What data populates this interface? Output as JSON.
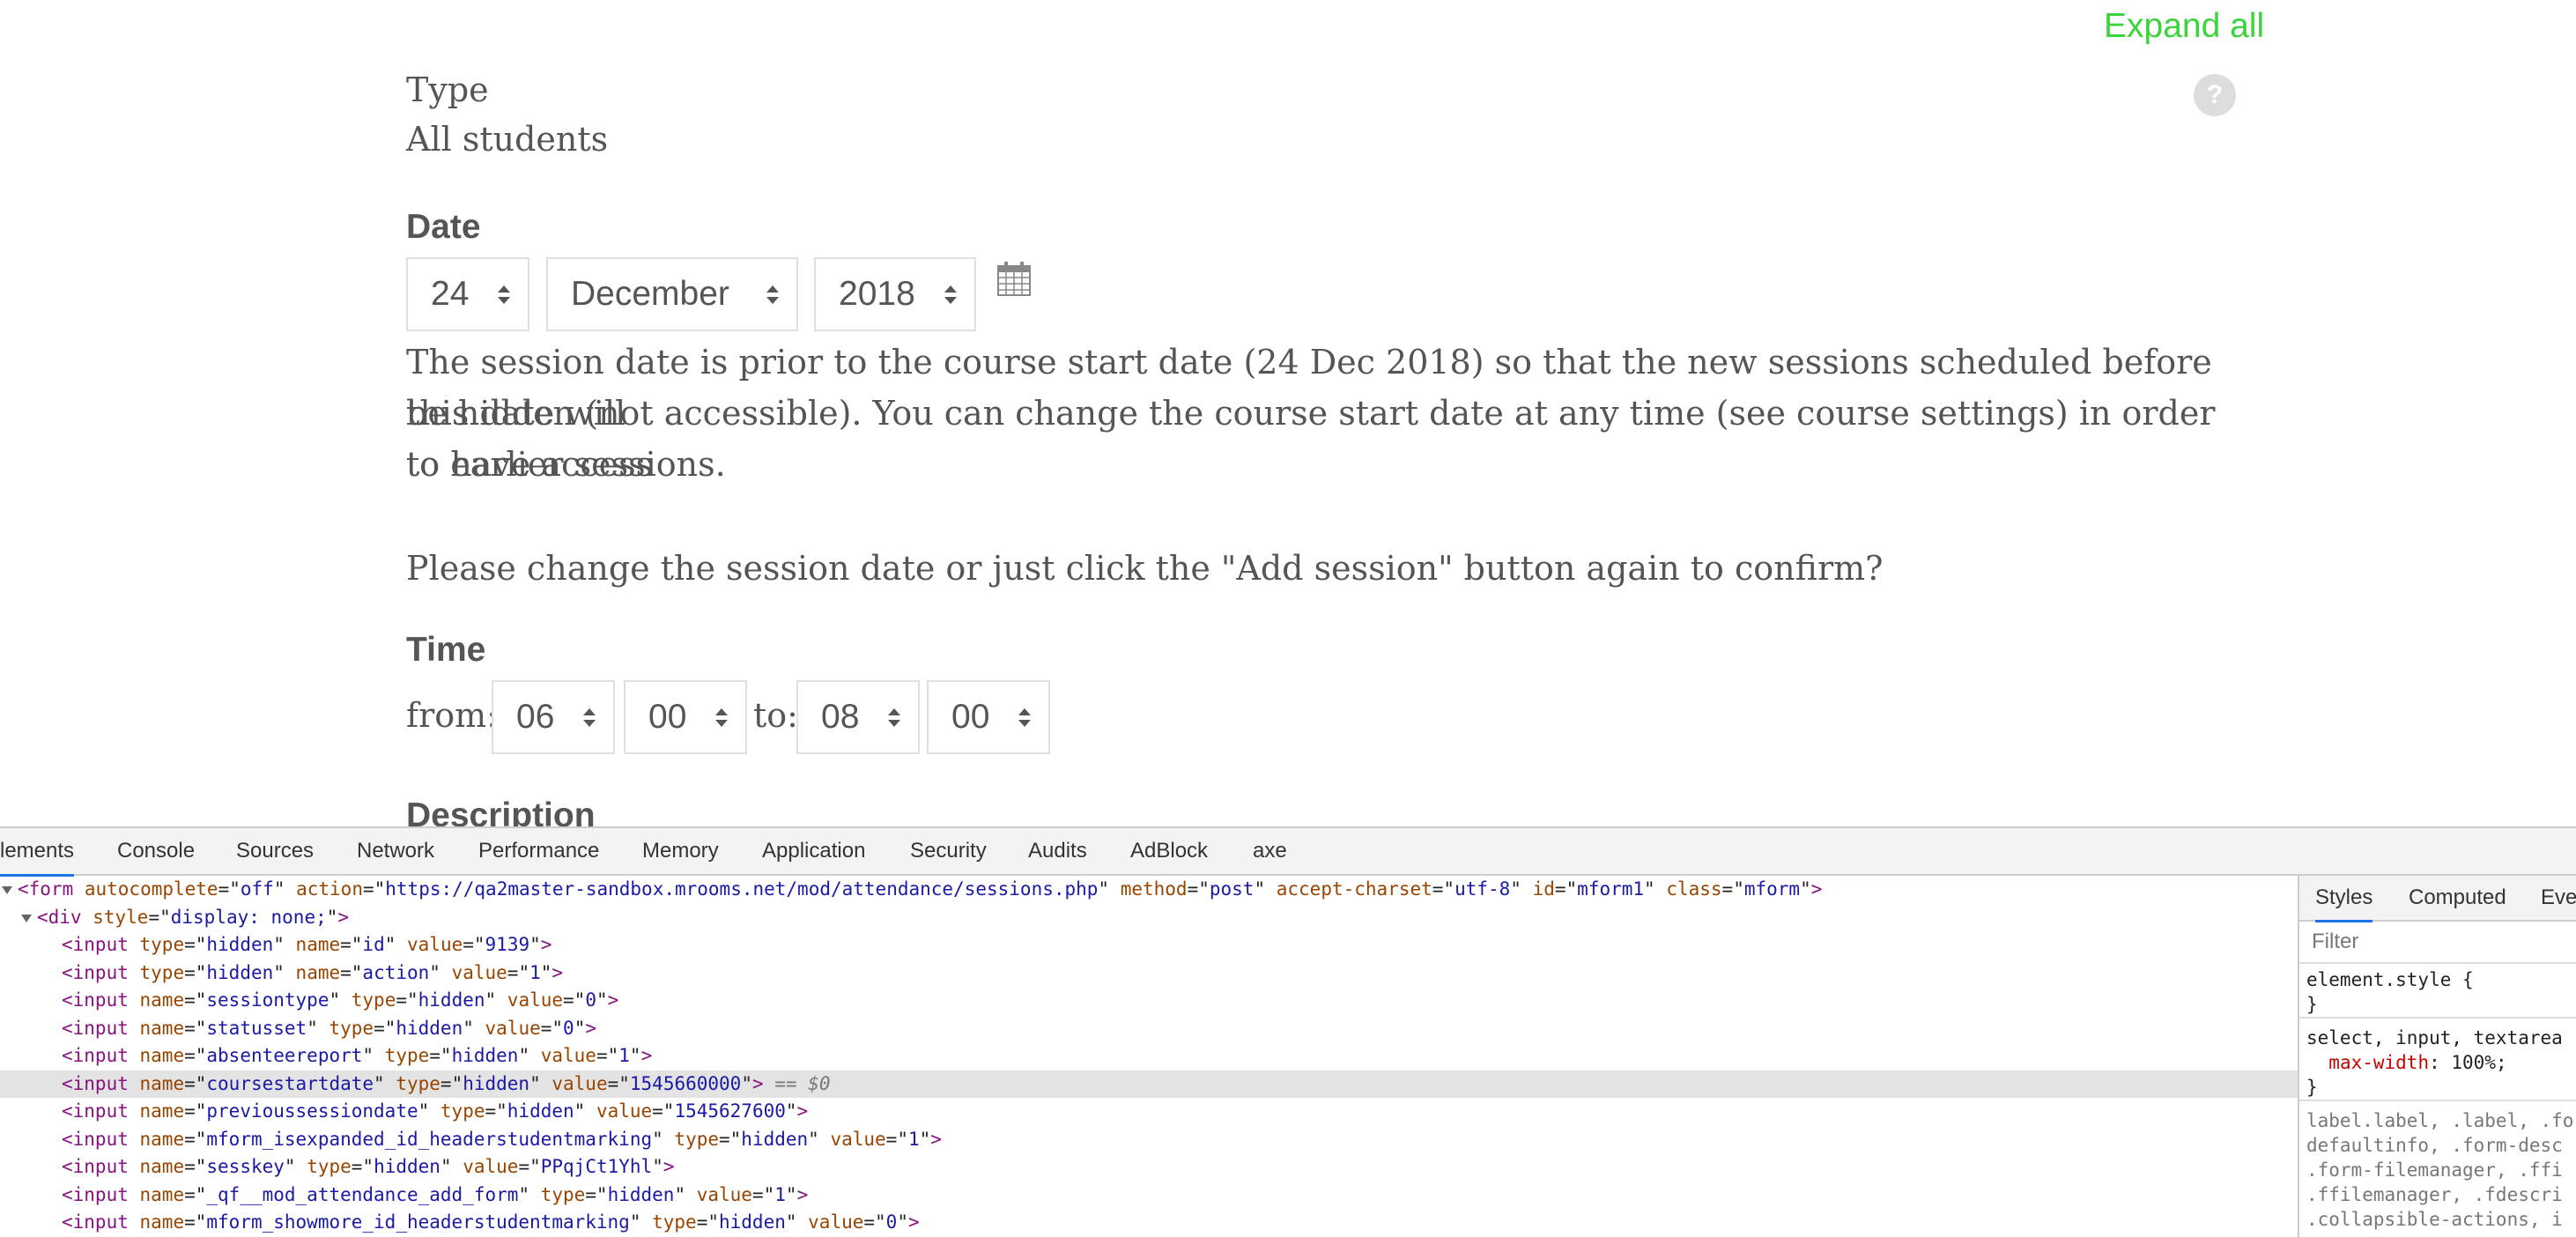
{
  "header": {
    "expand_all": "Expand all",
    "help_icon": "?"
  },
  "type_field": {
    "label": "Type",
    "value": "All students"
  },
  "date_field": {
    "label": "Date",
    "day": "24",
    "month": "December",
    "year": "2018",
    "calendar_icon": "calendar-icon"
  },
  "warning": {
    "line1": "The session date is prior to the course start date (24 Dec 2018) so that the new sessions scheduled before this date will",
    "line2": "be hidden (not accessible). You can change the course start date at any time (see course settings) in order to have access",
    "line3": "to earlier sessions.",
    "confirm": "Please change the session date or just click the \"Add session\" button again to confirm?"
  },
  "time_field": {
    "label": "Time",
    "from_label": "from:",
    "from_hour": "06",
    "from_minute": "00",
    "to_label": "to:",
    "to_hour": "08",
    "to_minute": "00"
  },
  "description_label": "Description",
  "devtools": {
    "tabs": [
      "lements",
      "Console",
      "Sources",
      "Network",
      "Performance",
      "Memory",
      "Application",
      "Security",
      "Audits",
      "AdBlock",
      "axe"
    ],
    "active_tab": "lements",
    "code_lines": [
      {
        "indent": 0,
        "tri": true,
        "parts": [
          [
            "tg",
            "<form "
          ],
          [
            "an",
            "autocomplete"
          ],
          [
            "pl",
            "=\""
          ],
          [
            "av",
            "off"
          ],
          [
            "pl",
            "\" "
          ],
          [
            "an",
            "action"
          ],
          [
            "pl",
            "=\""
          ],
          [
            "av",
            "https://qa2master-sandbox.mrooms.net/mod/attendance/sessions.php"
          ],
          [
            "pl",
            "\" "
          ],
          [
            "an",
            "method"
          ],
          [
            "pl",
            "=\""
          ],
          [
            "av",
            "post"
          ],
          [
            "pl",
            "\" "
          ],
          [
            "an",
            "accept-charset"
          ],
          [
            "pl",
            "=\""
          ],
          [
            "av",
            "utf-8"
          ],
          [
            "pl",
            "\" "
          ],
          [
            "an",
            "id"
          ],
          [
            "pl",
            "=\""
          ],
          [
            "av",
            "mform1"
          ],
          [
            "pl",
            "\" "
          ],
          [
            "an",
            "class"
          ],
          [
            "pl",
            "=\""
          ],
          [
            "av",
            "mform"
          ],
          [
            "pl",
            "\""
          ],
          [
            "tg",
            ">"
          ]
        ]
      },
      {
        "indent": 1,
        "tri": true,
        "parts": [
          [
            "tg",
            "<div "
          ],
          [
            "an",
            "style"
          ],
          [
            "pl",
            "=\""
          ],
          [
            "av",
            "display: none;"
          ],
          [
            "pl",
            "\""
          ],
          [
            "tg",
            ">"
          ]
        ]
      },
      {
        "indent": 2,
        "tri": false,
        "parts": [
          [
            "tg",
            "<input "
          ],
          [
            "an",
            "type"
          ],
          [
            "pl",
            "=\""
          ],
          [
            "av",
            "hidden"
          ],
          [
            "pl",
            "\" "
          ],
          [
            "an",
            "name"
          ],
          [
            "pl",
            "=\""
          ],
          [
            "av",
            "id"
          ],
          [
            "pl",
            "\" "
          ],
          [
            "an",
            "value"
          ],
          [
            "pl",
            "=\""
          ],
          [
            "av",
            "9139"
          ],
          [
            "pl",
            "\""
          ],
          [
            "tg",
            ">"
          ]
        ]
      },
      {
        "indent": 2,
        "tri": false,
        "parts": [
          [
            "tg",
            "<input "
          ],
          [
            "an",
            "type"
          ],
          [
            "pl",
            "=\""
          ],
          [
            "av",
            "hidden"
          ],
          [
            "pl",
            "\" "
          ],
          [
            "an",
            "name"
          ],
          [
            "pl",
            "=\""
          ],
          [
            "av",
            "action"
          ],
          [
            "pl",
            "\" "
          ],
          [
            "an",
            "value"
          ],
          [
            "pl",
            "=\""
          ],
          [
            "av",
            "1"
          ],
          [
            "pl",
            "\""
          ],
          [
            "tg",
            ">"
          ]
        ]
      },
      {
        "indent": 2,
        "tri": false,
        "parts": [
          [
            "tg",
            "<input "
          ],
          [
            "an",
            "name"
          ],
          [
            "pl",
            "=\""
          ],
          [
            "av",
            "sessiontype"
          ],
          [
            "pl",
            "\" "
          ],
          [
            "an",
            "type"
          ],
          [
            "pl",
            "=\""
          ],
          [
            "av",
            "hidden"
          ],
          [
            "pl",
            "\" "
          ],
          [
            "an",
            "value"
          ],
          [
            "pl",
            "=\""
          ],
          [
            "av",
            "0"
          ],
          [
            "pl",
            "\""
          ],
          [
            "tg",
            ">"
          ]
        ]
      },
      {
        "indent": 2,
        "tri": false,
        "parts": [
          [
            "tg",
            "<input "
          ],
          [
            "an",
            "name"
          ],
          [
            "pl",
            "=\""
          ],
          [
            "av",
            "statusset"
          ],
          [
            "pl",
            "\" "
          ],
          [
            "an",
            "type"
          ],
          [
            "pl",
            "=\""
          ],
          [
            "av",
            "hidden"
          ],
          [
            "pl",
            "\" "
          ],
          [
            "an",
            "value"
          ],
          [
            "pl",
            "=\""
          ],
          [
            "av",
            "0"
          ],
          [
            "pl",
            "\""
          ],
          [
            "tg",
            ">"
          ]
        ]
      },
      {
        "indent": 2,
        "tri": false,
        "parts": [
          [
            "tg",
            "<input "
          ],
          [
            "an",
            "name"
          ],
          [
            "pl",
            "=\""
          ],
          [
            "av",
            "absenteereport"
          ],
          [
            "pl",
            "\" "
          ],
          [
            "an",
            "type"
          ],
          [
            "pl",
            "=\""
          ],
          [
            "av",
            "hidden"
          ],
          [
            "pl",
            "\" "
          ],
          [
            "an",
            "value"
          ],
          [
            "pl",
            "=\""
          ],
          [
            "av",
            "1"
          ],
          [
            "pl",
            "\""
          ],
          [
            "tg",
            ">"
          ]
        ]
      },
      {
        "indent": 2,
        "tri": false,
        "selected": true,
        "parts": [
          [
            "tg",
            "<input "
          ],
          [
            "an",
            "name"
          ],
          [
            "pl",
            "=\""
          ],
          [
            "av",
            "coursestartdate"
          ],
          [
            "pl",
            "\" "
          ],
          [
            "an",
            "type"
          ],
          [
            "pl",
            "=\""
          ],
          [
            "av",
            "hidden"
          ],
          [
            "pl",
            "\" "
          ],
          [
            "an",
            "value"
          ],
          [
            "pl",
            "=\""
          ],
          [
            "av",
            "1545660000"
          ],
          [
            "pl",
            "\""
          ],
          [
            "tg",
            ">"
          ],
          [
            "sel-note",
            " == $0"
          ]
        ]
      },
      {
        "indent": 2,
        "tri": false,
        "parts": [
          [
            "tg",
            "<input "
          ],
          [
            "an",
            "name"
          ],
          [
            "pl",
            "=\""
          ],
          [
            "av",
            "previoussessiondate"
          ],
          [
            "pl",
            "\" "
          ],
          [
            "an",
            "type"
          ],
          [
            "pl",
            "=\""
          ],
          [
            "av",
            "hidden"
          ],
          [
            "pl",
            "\" "
          ],
          [
            "an",
            "value"
          ],
          [
            "pl",
            "=\""
          ],
          [
            "av",
            "1545627600"
          ],
          [
            "pl",
            "\""
          ],
          [
            "tg",
            ">"
          ]
        ]
      },
      {
        "indent": 2,
        "tri": false,
        "parts": [
          [
            "tg",
            "<input "
          ],
          [
            "an",
            "name"
          ],
          [
            "pl",
            "=\""
          ],
          [
            "av",
            "mform_isexpanded_id_headerstudentmarking"
          ],
          [
            "pl",
            "\" "
          ],
          [
            "an",
            "type"
          ],
          [
            "pl",
            "=\""
          ],
          [
            "av",
            "hidden"
          ],
          [
            "pl",
            "\" "
          ],
          [
            "an",
            "value"
          ],
          [
            "pl",
            "=\""
          ],
          [
            "av",
            "1"
          ],
          [
            "pl",
            "\""
          ],
          [
            "tg",
            ">"
          ]
        ]
      },
      {
        "indent": 2,
        "tri": false,
        "parts": [
          [
            "tg",
            "<input "
          ],
          [
            "an",
            "name"
          ],
          [
            "pl",
            "=\""
          ],
          [
            "av",
            "sesskey"
          ],
          [
            "pl",
            "\" "
          ],
          [
            "an",
            "type"
          ],
          [
            "pl",
            "=\""
          ],
          [
            "av",
            "hidden"
          ],
          [
            "pl",
            "\" "
          ],
          [
            "an",
            "value"
          ],
          [
            "pl",
            "=\""
          ],
          [
            "av",
            "PPqjCt1Yhl"
          ],
          [
            "pl",
            "\""
          ],
          [
            "tg",
            ">"
          ]
        ]
      },
      {
        "indent": 2,
        "tri": false,
        "parts": [
          [
            "tg",
            "<input "
          ],
          [
            "an",
            "name"
          ],
          [
            "pl",
            "=\""
          ],
          [
            "av",
            "_qf__mod_attendance_add_form"
          ],
          [
            "pl",
            "\" "
          ],
          [
            "an",
            "type"
          ],
          [
            "pl",
            "=\""
          ],
          [
            "av",
            "hidden"
          ],
          [
            "pl",
            "\" "
          ],
          [
            "an",
            "value"
          ],
          [
            "pl",
            "=\""
          ],
          [
            "av",
            "1"
          ],
          [
            "pl",
            "\""
          ],
          [
            "tg",
            ">"
          ]
        ]
      },
      {
        "indent": 2,
        "tri": false,
        "parts": [
          [
            "tg",
            "<input "
          ],
          [
            "an",
            "name"
          ],
          [
            "pl",
            "=\""
          ],
          [
            "av",
            "mform_showmore_id_headerstudentmarking"
          ],
          [
            "pl",
            "\" "
          ],
          [
            "an",
            "type"
          ],
          [
            "pl",
            "=\""
          ],
          [
            "av",
            "hidden"
          ],
          [
            "pl",
            "\" "
          ],
          [
            "an",
            "value"
          ],
          [
            "pl",
            "=\""
          ],
          [
            "av",
            "0"
          ],
          [
            "pl",
            "\""
          ],
          [
            "tg",
            ">"
          ]
        ]
      }
    ],
    "styles_panel": {
      "tabs": [
        "Styles",
        "Computed",
        "Eve"
      ],
      "filter_placeholder": "Filter",
      "element_style": [
        "element.style {",
        "}"
      ],
      "rule1": {
        "selector": "select, input, textarea",
        "prop": "max-width",
        "value": "100%;",
        "close": "}"
      },
      "rule2": [
        ".label, .label, .form-la",
        "defaultinfo, .form-desc",
        ".form-filemanager, .ffi",
        ".ffilemanager, .fdescri",
        ".collapsible-actions, i"
      ],
      "rule2_first": "label"
    }
  }
}
